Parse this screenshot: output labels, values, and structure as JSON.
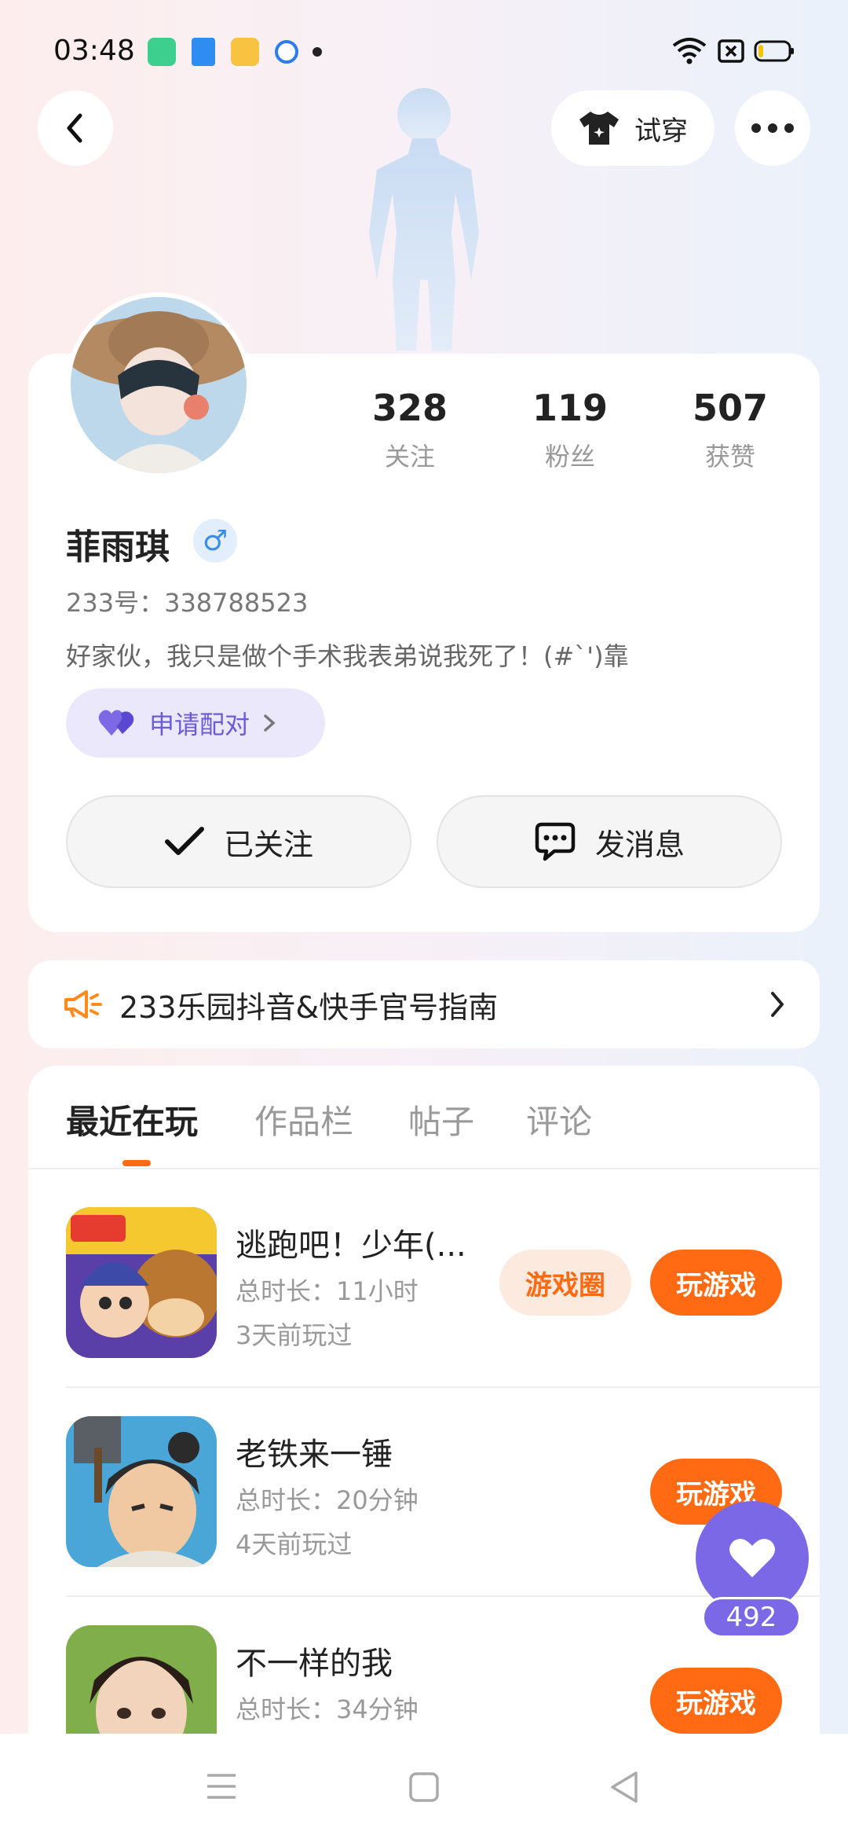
{
  "status_bar": {
    "time": "03:48"
  },
  "nav": {
    "try_on_label": "试穿"
  },
  "profile": {
    "stats": [
      {
        "value": "328",
        "label": "关注"
      },
      {
        "value": "119",
        "label": "粉丝"
      },
      {
        "value": "507",
        "label": "获赞"
      }
    ],
    "name": "菲雨琪",
    "gender_symbol": "♂",
    "id_line": "233号：338788523",
    "bio": "好家伙，我只是做个手术我表弟说我死了！(#`')靠",
    "pair_label": "申请配对",
    "follow_label": "已关注",
    "message_label": "发消息"
  },
  "notice": {
    "text": "233乐园抖音&快手官号指南"
  },
  "tabs": [
    {
      "label": "最近在玩"
    },
    {
      "label": "作品栏"
    },
    {
      "label": "帖子"
    },
    {
      "label": "评论"
    }
  ],
  "games": [
    {
      "title": "逃跑吧！少年(...",
      "duration": "总时长：11小时",
      "last_played": "3天前玩过",
      "circle_label": "游戏圈",
      "play_label": "玩游戏"
    },
    {
      "title": "老铁来一锤",
      "duration": "总时长：20分钟",
      "last_played": "4天前玩过",
      "play_label": "玩游戏"
    },
    {
      "title": "不一样的我",
      "duration": "总时长：34分钟",
      "last_played": "",
      "play_label": "玩游戏"
    }
  ],
  "like_fab": {
    "count": "492"
  },
  "colors": {
    "accent_orange": "#ff6a13",
    "purple": "#6c5ad9"
  }
}
